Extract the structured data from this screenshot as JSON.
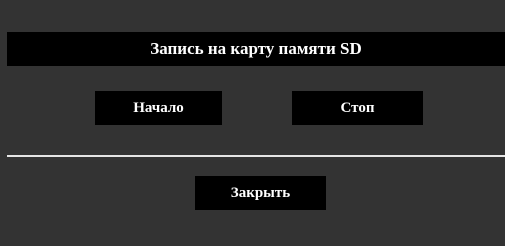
{
  "dialog": {
    "title": "Запись на карту памяти SD",
    "buttons": {
      "start_label": "Начало",
      "stop_label": "Стоп",
      "close_label": "Закрыть"
    }
  },
  "colors": {
    "panel_background": "#333333",
    "bar_background": "#000000",
    "text": "#ffffff",
    "divider": "#e6e6e6"
  }
}
